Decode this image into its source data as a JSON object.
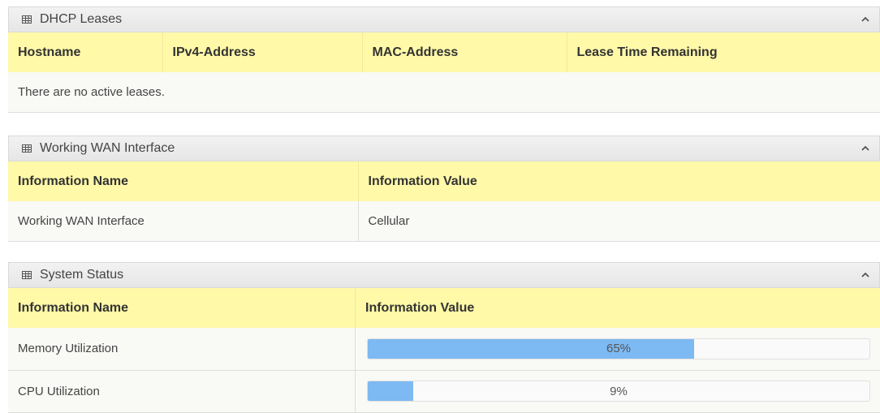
{
  "dhcp": {
    "title": "DHCP Leases",
    "columns": [
      "Hostname",
      "IPv4-Address",
      "MAC-Address",
      "Lease Time Remaining"
    ],
    "empty_message": "There are no active leases."
  },
  "wan": {
    "title": "Working WAN Interface",
    "columns": [
      "Information Name",
      "Information Value"
    ],
    "rows": [
      {
        "name": "Working WAN Interface",
        "value": "Cellular"
      }
    ]
  },
  "system": {
    "title": "System Status",
    "columns": [
      "Information Name",
      "Information Value"
    ],
    "rows": [
      {
        "name": "Memory Utilization",
        "value_label": "65%",
        "percent": 65
      },
      {
        "name": "CPU Utilization",
        "value_label": "9%",
        "percent": 9
      }
    ]
  },
  "icons": {
    "panel_icon": "table-grid-icon",
    "collapse_icon": "chevron-up-icon"
  },
  "colors": {
    "header_yellow": "#fff9a8",
    "progress_blue": "#7db9f3"
  }
}
